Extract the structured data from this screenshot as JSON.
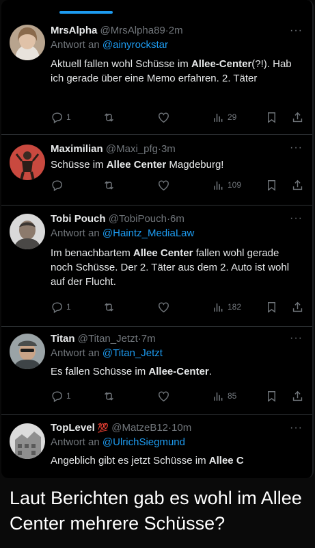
{
  "tweets": [
    {
      "name": "MrsAlpha",
      "handle": "@MrsAlpha89",
      "time": "2m",
      "reply_label": "Antwort an",
      "reply_to": "@ainyrockstar",
      "text_parts": [
        "Aktuell fallen wohl Schüsse im ",
        "Allee-Center",
        "(?!). Hab ich gerade über eine Memo erfahren. 2. Täter"
      ],
      "counts": {
        "reply": "1",
        "retweet": "",
        "like": "",
        "views": "29"
      }
    },
    {
      "name": "Maximilian",
      "handle": "@Maxi_pfg",
      "time": "3m",
      "text_parts": [
        "Schüsse im ",
        "Allee Center",
        " Magdeburg!"
      ],
      "counts": {
        "reply": "",
        "retweet": "",
        "like": "",
        "views": "109"
      }
    },
    {
      "name": "Tobi Pouch",
      "handle": "@TobiPouch",
      "time": "6m",
      "reply_label": "Antwort an",
      "reply_to": "@Haintz_MediaLaw",
      "text_parts": [
        "Im benachbartem ",
        "Allee Center",
        " fallen wohl gerade noch Schüsse. Der 2. Täter aus dem 2. Auto ist wohl auf der Flucht."
      ],
      "counts": {
        "reply": "1",
        "retweet": "",
        "like": "",
        "views": "182"
      }
    },
    {
      "name": "Titan",
      "handle": "@Titan_Jetzt",
      "time": "7m",
      "reply_label": "Antwort an",
      "reply_to": "@Titan_Jetzt",
      "text_parts": [
        "Es fallen Schüsse im ",
        "Allee-Center",
        "."
      ],
      "counts": {
        "reply": "1",
        "retweet": "",
        "like": "",
        "views": "85"
      }
    },
    {
      "name": "TopLevel",
      "emoji": "💯",
      "handle": "@MatzeB12",
      "time": "10m",
      "reply_label": "Antwort an",
      "reply_to": "@UlrichSiegmund",
      "text_parts": [
        "Angeblich gibt es jetzt Schüsse im ",
        "Allee C",
        ""
      ]
    }
  ],
  "separator": "·",
  "caption": "Laut Berichten gab es wohl im Allee Center mehrere Schüsse?",
  "colors": {
    "accent": "#1d9bf0",
    "muted": "#71767b",
    "text": "#e7e9ea",
    "background": "#000000"
  },
  "icons": [
    "reply-icon",
    "retweet-icon",
    "like-icon",
    "views-icon",
    "bookmark-icon",
    "share-icon",
    "more-icon"
  ]
}
